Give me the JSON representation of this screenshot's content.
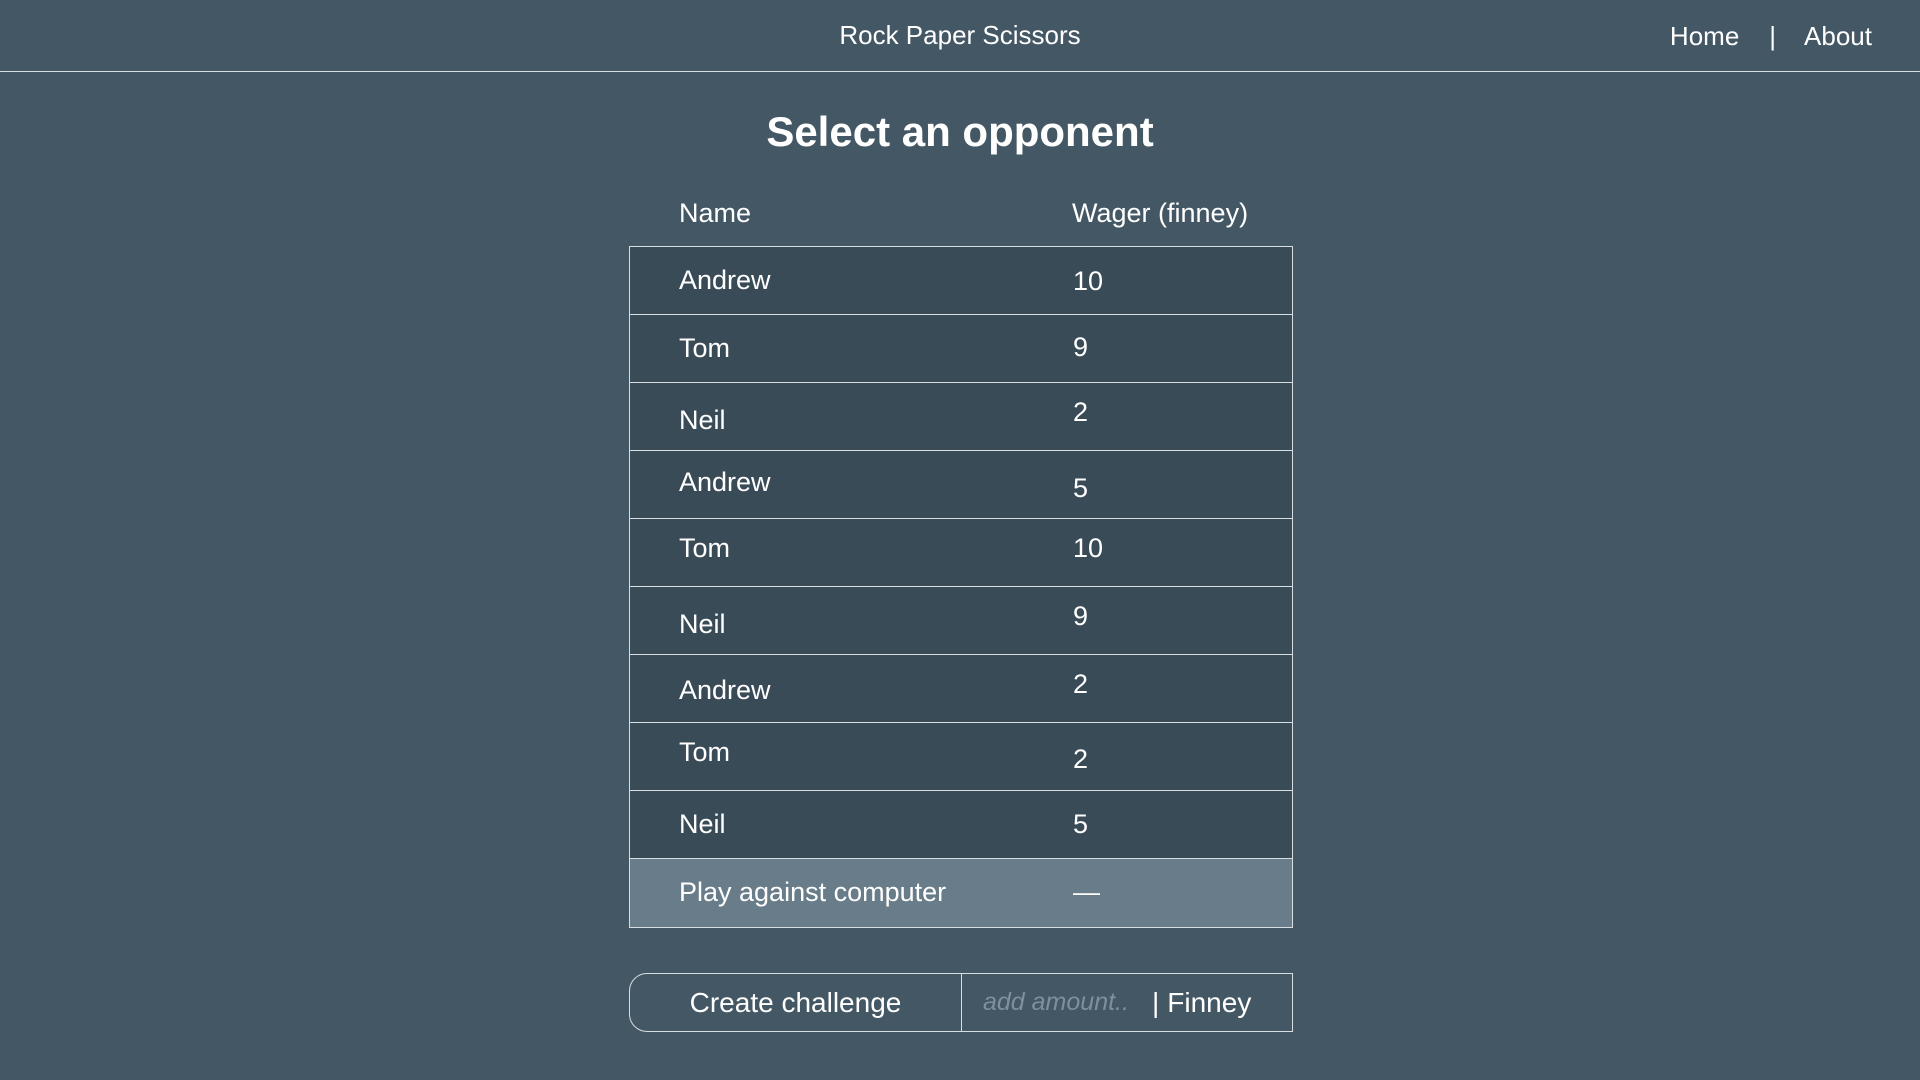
{
  "header": {
    "title": "Rock Paper Scissors",
    "nav": {
      "home": "Home",
      "separator": "|",
      "about": "About"
    }
  },
  "main": {
    "heading": "Select an opponent",
    "columns": {
      "name": "Name",
      "wager": "Wager (finney)"
    },
    "opponents": [
      {
        "name": "Andrew",
        "wager": "10"
      },
      {
        "name": "Tom",
        "wager": "9"
      },
      {
        "name": "Neil",
        "wager": "2"
      },
      {
        "name": "Andrew",
        "wager": "5"
      },
      {
        "name": "Tom",
        "wager": "10"
      },
      {
        "name": "Neil",
        "wager": "9"
      },
      {
        "name": "Andrew",
        "wager": "2"
      },
      {
        "name": "Tom",
        "wager": "2"
      },
      {
        "name": "Neil",
        "wager": "5"
      }
    ],
    "computer": {
      "name": "Play against computer",
      "wager": "—"
    }
  },
  "create": {
    "button_label": "Create challenge",
    "amount_placeholder": "add amount..",
    "amount_value": "",
    "unit_separator": "|",
    "unit_label": "Finney"
  }
}
